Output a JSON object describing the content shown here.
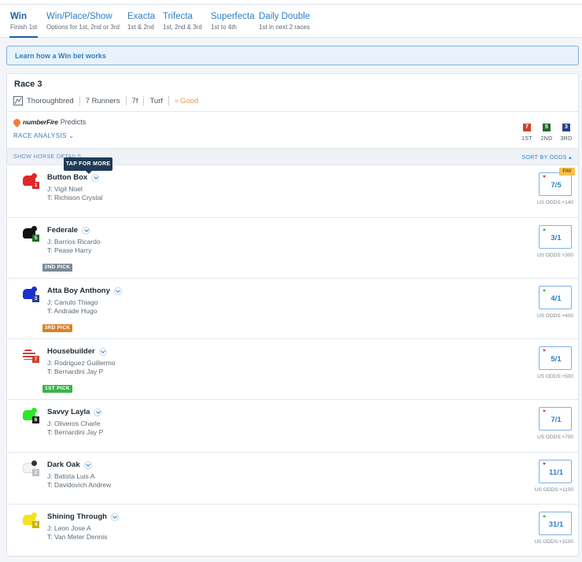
{
  "tabs": [
    {
      "name": "Win",
      "sub": "Finish 1st",
      "active": true
    },
    {
      "name": "Win/Place/Show",
      "sub": "Options for 1st, 2nd or 3rd"
    },
    {
      "name": "Exacta",
      "sub": "1st & 2nd"
    },
    {
      "name": "Trifecta",
      "sub": "1st, 2nd & 3rd"
    },
    {
      "name": "Superfecta",
      "sub": "1st to 4th"
    },
    {
      "name": "Daily Double",
      "sub": "1st in next 2 races"
    }
  ],
  "learn_link": "Learn how a Win bet works",
  "race": {
    "title": "Race 3",
    "breed": "Thoroughbred",
    "runners": "7 Runners",
    "distance": "7f",
    "surface": "Turf",
    "condition": "Good"
  },
  "predicts": {
    "brand": "numberFire",
    "label": "Predicts",
    "analysis": "RACE ANALYSIS",
    "picks": [
      {
        "number": "7",
        "label": "1ST",
        "color": "#c8452c"
      },
      {
        "number": "5",
        "label": "2ND",
        "color": "#1e6b2a"
      },
      {
        "number": "3",
        "label": "3RD",
        "color": "#27408b"
      }
    ]
  },
  "subbar": {
    "show_details": "SHOW HORSE DETAILS",
    "sort": "SORT BY ODDS"
  },
  "tooltip": "TAP FOR MORE",
  "fav_label": "FAV",
  "runners": [
    {
      "name": "Button Box",
      "jockey": "J: Vigil Noel",
      "trainer": "T: Richison Crystal",
      "number": "1",
      "num_color": "#d62b2b",
      "silk_color": "#e32626",
      "cap_color": "#e32626",
      "odds": "7/5",
      "us_odds": "US ODDS:+140",
      "trend": "down",
      "fav": true,
      "pick": ""
    },
    {
      "name": "Federale",
      "jockey": "J: Barrios Ricardo",
      "trainer": "T: Pease Harry",
      "number": "5",
      "num_color": "#1e6b2a",
      "silk_color": "#111111",
      "cap_color": "#111111",
      "odds": "3/1",
      "us_odds": "US ODDS:+300",
      "trend": "up",
      "fav": false,
      "pick": "2ND PICK",
      "pick_color": "#7d8a96"
    },
    {
      "name": "Atta Boy Anthony",
      "jockey": "J: Canuto Thiago",
      "trainer": "T: Andrade Hugo",
      "number": "3",
      "num_color": "#27408b",
      "silk_color": "#1c2fd1",
      "cap_color": "#1c2fd1",
      "odds": "4/1",
      "us_odds": "US ODDS:+400",
      "trend": "up",
      "fav": false,
      "pick": "3RD PICK",
      "pick_color": "#d9822b"
    },
    {
      "name": "Housebuilder",
      "jockey": "J: Rodriguez Guillermo",
      "trainer": "T: Bernardini Jay P",
      "number": "7",
      "num_color": "#c8452c",
      "silk_color": "#d63a3a",
      "cap_color": "#ffffff",
      "odds": "5/1",
      "us_odds": "US ODDS:+500",
      "trend": "down",
      "fav": false,
      "pick": "1ST PICK",
      "pick_color": "#3bb54a"
    },
    {
      "name": "Savvy Layla",
      "jockey": "J: Oliveros Charle",
      "trainer": "T: Bernardini Jay P",
      "number": "6",
      "num_color": "#222222",
      "silk_color": "#2ee62e",
      "cap_color": "#2ee62e",
      "odds": "7/1",
      "us_odds": "US ODDS:+700",
      "trend": "down",
      "fav": false,
      "pick": ""
    },
    {
      "name": "Dark Oak",
      "jockey": "J: Batista Luis A",
      "trainer": "T: Davidovich Andrew",
      "number": "2",
      "num_color": "#b9c0c7",
      "silk_color": "#f4f4f4",
      "cap_color": "#333333",
      "odds": "11/1",
      "us_odds": "US ODDS:+1100",
      "trend": "down",
      "fav": false,
      "pick": ""
    },
    {
      "name": "Shining Through",
      "jockey": "J: Leon Jose A",
      "trainer": "T: Van Meter Dennis",
      "number": "4",
      "num_color": "#c9b400",
      "silk_color": "#f2e51d",
      "cap_color": "#f2e51d",
      "odds": "31/1",
      "us_odds": "US ODDS:+3100",
      "trend": "up",
      "fav": false,
      "pick": ""
    }
  ]
}
